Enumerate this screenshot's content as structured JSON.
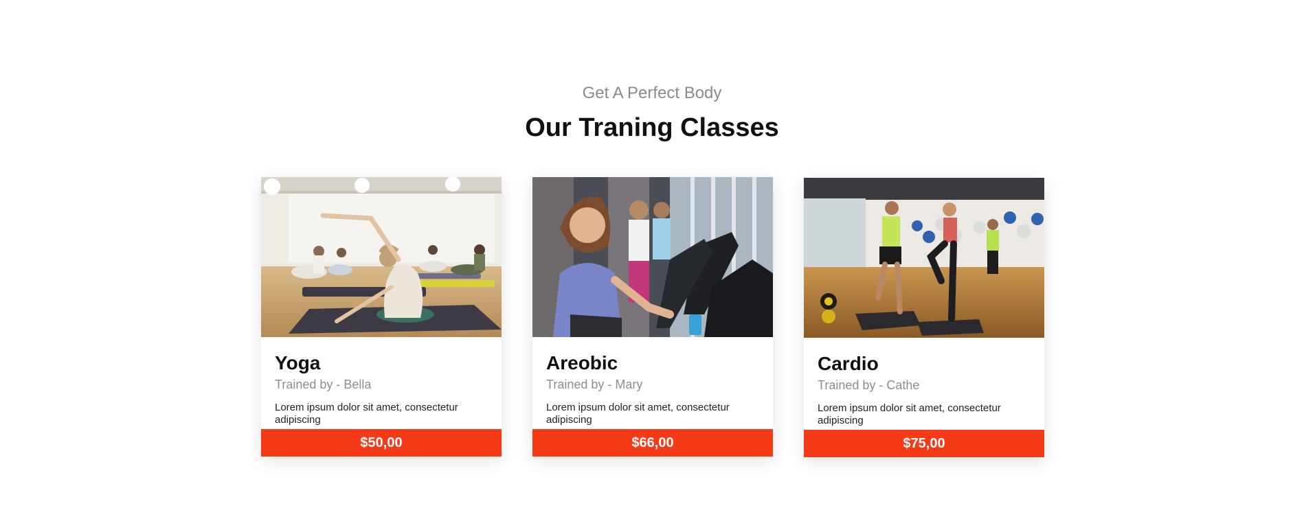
{
  "header": {
    "subtitle": "Get A Perfect Body",
    "title": "Our Traning Classes"
  },
  "classes": [
    {
      "name": "Yoga",
      "trainer": "Trained by - Bella",
      "description": "Lorem ipsum dolor sit amet, consectetur adipiscing",
      "price": "$50,00",
      "image_icon": "yoga-class-photo"
    },
    {
      "name": "Areobic",
      "trainer": "Trained by - Mary",
      "description": "Lorem ipsum dolor sit amet, consectetur adipiscing",
      "price": "$66,00",
      "image_icon": "aerobic-class-photo"
    },
    {
      "name": "Cardio",
      "trainer": "Trained by - Cathe",
      "description": "Lorem ipsum dolor sit amet, consectetur adipiscing",
      "price": "$75,00",
      "image_icon": "cardio-class-photo"
    }
  ],
  "colors": {
    "accent": "#f43a16",
    "title": "#111111",
    "muted": "#8a8a8a"
  }
}
